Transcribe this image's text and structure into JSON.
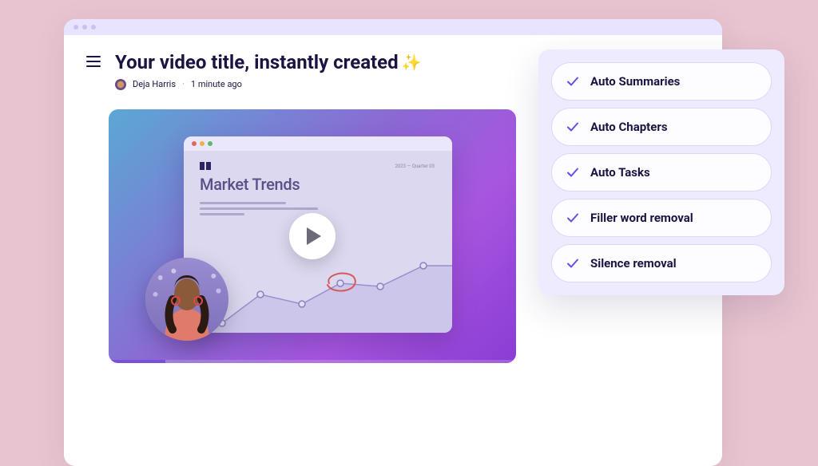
{
  "header": {
    "title": "Your video title, instantly created",
    "author": "Deja Harris",
    "timestamp": "1 minute ago"
  },
  "video_slide": {
    "title": "Market Trends",
    "date_label": "2023 — Quarter 03"
  },
  "features": [
    {
      "label": "Auto Summaries"
    },
    {
      "label": "Auto Chapters"
    },
    {
      "label": "Auto Tasks"
    },
    {
      "label": "Filler word removal"
    },
    {
      "label": "Silence removal"
    }
  ],
  "chart_data": {
    "type": "line",
    "title": "Market Trends",
    "x": [
      1,
      2,
      3,
      4,
      5,
      6,
      7
    ],
    "values": [
      26,
      10,
      40,
      30,
      52,
      48,
      70
    ],
    "xlabel": "",
    "ylabel": "",
    "ylim": [
      0,
      100
    ]
  }
}
